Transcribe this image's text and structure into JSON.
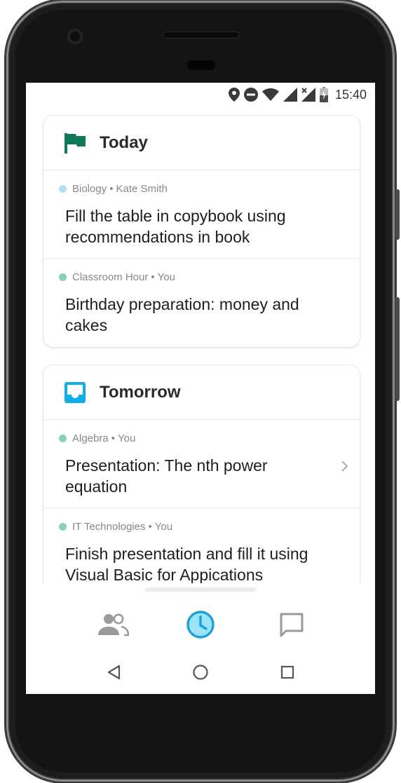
{
  "status_bar": {
    "time": "15:40",
    "icons": [
      "location-icon",
      "do-not-disturb-icon",
      "wifi-icon",
      "signal-icon",
      "signal-no-data-icon",
      "battery-charging-icon"
    ]
  },
  "colors": {
    "today_flag": "#0f7a5a",
    "tomorrow_inbox": "#12aee8",
    "dot_light_blue": "#b3def7",
    "dot_green": "#86d1b8",
    "active_nav_bg": "#9be3f7",
    "active_nav_stroke": "#1e9fd6",
    "inactive_nav": "#9a9a9a"
  },
  "sections": [
    {
      "title": "Today",
      "icon": "flag-icon",
      "tasks": [
        {
          "subject": "Biology",
          "separator": "•",
          "author": "Kate Smith",
          "dot": "light-blue",
          "text": "Fill the table in copybook using recommendations in book"
        },
        {
          "subject": "Classroom Hour",
          "separator": "•",
          "author": "You",
          "dot": "green",
          "text": "Birthday preparation: money and cakes"
        }
      ]
    },
    {
      "title": "Tomorrow",
      "icon": "inbox-icon",
      "tasks": [
        {
          "subject": "Algebra",
          "separator": "•",
          "author": "You",
          "dot": "green",
          "text": "Presentation: The nth power equation",
          "has_chevron": true
        },
        {
          "subject": "IT Technologies",
          "separator": "•",
          "author": "You",
          "dot": "green",
          "text": "Finish presentation and fill it using Visual Basic for Appications"
        }
      ]
    }
  ],
  "bottom_nav": {
    "items": [
      "people-icon",
      "clock-icon",
      "chat-icon"
    ],
    "active": "clock-icon"
  },
  "system_nav": [
    "back-icon",
    "home-icon",
    "recents-icon"
  ]
}
